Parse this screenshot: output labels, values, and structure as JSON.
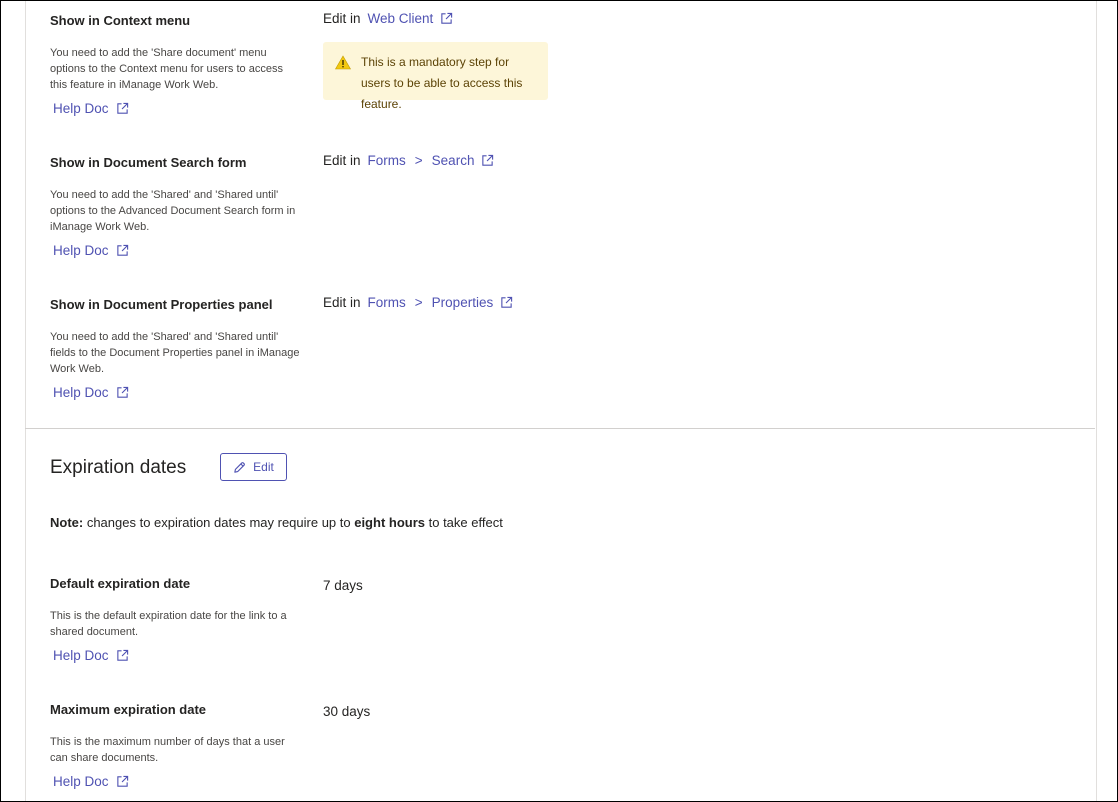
{
  "share_options": {
    "context_menu": {
      "title": "Show in Context menu",
      "description": "You need to add the 'Share document' menu options to the Context menu for users to access this feature in iManage Work Web.",
      "help_label": "Help Doc",
      "edit_prefix": "Edit in",
      "link_label": "Web Client",
      "warning": "This is a mandatory step for users to be able to access this feature."
    },
    "search_form": {
      "title": "Show in Document Search form",
      "description": "You need to add the 'Shared' and 'Shared until' options to the Advanced Document Search form in iManage Work Web.",
      "help_label": "Help Doc",
      "edit_prefix": "Edit in",
      "link_1": "Forms",
      "separator": ">",
      "link_2": "Search"
    },
    "properties_panel": {
      "title": "Show in Document Properties panel",
      "description": "You need to add the 'Shared' and 'Shared until' fields to the Document Properties panel in iManage Work Web.",
      "help_label": "Help Doc",
      "edit_prefix": "Edit in",
      "link_1": "Forms",
      "separator": ">",
      "link_2": "Properties"
    }
  },
  "expiration": {
    "title": "Expiration dates",
    "edit_label": "Edit",
    "note_label": "Note:",
    "note_text_1": " changes to expiration dates may require up to ",
    "note_bold": "eight hours",
    "note_text_2": " to take effect",
    "default": {
      "title": "Default expiration date",
      "description": "This is the default expiration date for the link to a shared document.",
      "help_label": "Help Doc",
      "value": "7 days"
    },
    "maximum": {
      "title": "Maximum expiration date",
      "description": "This is the maximum number of days that a user can share documents.",
      "help_label": "Help Doc",
      "value": "30 days"
    }
  },
  "colors": {
    "link": "#4f52b2",
    "warning_bg": "#fdf6d9",
    "warning_icon": "#f2c811"
  }
}
